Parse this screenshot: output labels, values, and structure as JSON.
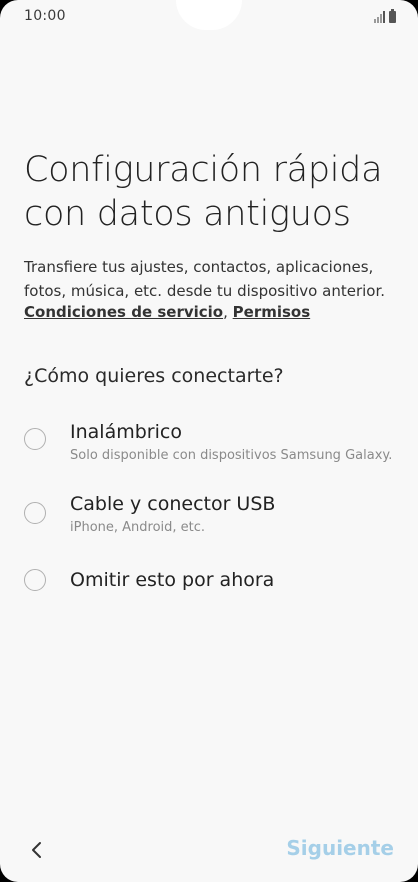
{
  "status_bar": {
    "time": "10:00"
  },
  "page": {
    "title_line1": "Configuración rápida",
    "title_line2": "con datos antiguos",
    "description_line1": "Transfiere tus ajustes, contactos, aplicaciones,",
    "description_line2": "fotos, música, etc. desde tu dispositivo anterior.",
    "terms_link": "Condiciones de servicio",
    "separator": ", ",
    "permissions_link": "Permisos",
    "question": "¿Cómo quieres conectarte?"
  },
  "options": [
    {
      "label": "Inalámbrico",
      "sub": "Solo disponible con dispositivos Samsung Galaxy."
    },
    {
      "label": "Cable y conector USB",
      "sub": "iPhone, Android, etc."
    },
    {
      "label": "Omitir esto por ahora",
      "sub": ""
    }
  ],
  "footer": {
    "next_label": "Siguiente"
  },
  "colors": {
    "next_button_disabled": "#a5cfe8",
    "background": "#f8f8f8"
  }
}
